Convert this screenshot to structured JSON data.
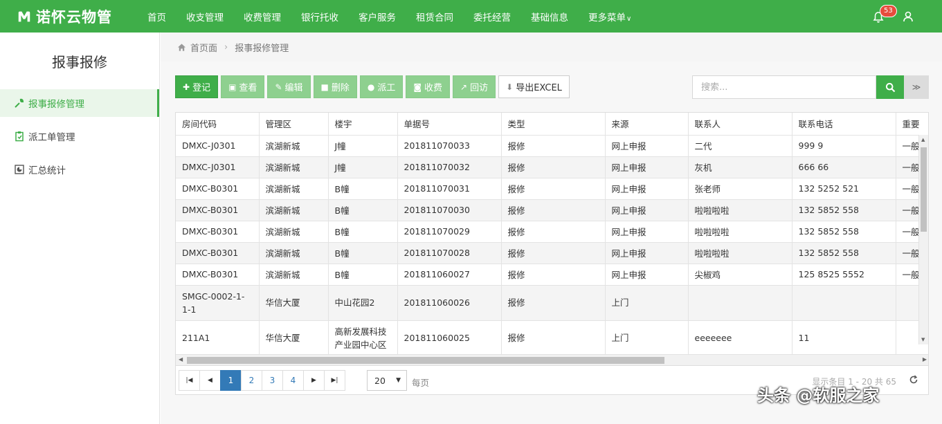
{
  "app": {
    "brand_name": "诺怀云物管",
    "logo_icon": "m-logo-icon",
    "accent_color": "#3fae49"
  },
  "nav": {
    "items": [
      "首页",
      "收支管理",
      "收费管理",
      "银行托收",
      "客户服务",
      "租赁合同",
      "委托经营",
      "基础信息"
    ],
    "more_label": "更多菜单",
    "notification_count": "53"
  },
  "sidebar": {
    "title": "报事报修",
    "items": [
      {
        "label": "报事报修管理",
        "icon": "wrench-icon",
        "active": true
      },
      {
        "label": "派工单管理",
        "icon": "clipboard-icon",
        "active": false
      },
      {
        "label": "汇总统计",
        "icon": "chart-icon",
        "active": false
      }
    ]
  },
  "breadcrumb": {
    "home": "首页面",
    "current": "报事报修管理"
  },
  "toolbar": {
    "register": "登记",
    "view": "查看",
    "edit": "编辑",
    "delete": "删除",
    "dispatch": "派工",
    "charge": "收费",
    "revisit": "回访",
    "export": "导出EXCEL"
  },
  "search": {
    "placeholder": "搜索..."
  },
  "table": {
    "columns": [
      "房间代码",
      "管理区",
      "楼宇",
      "单据号",
      "类型",
      "来源",
      "联系人",
      "联系电话",
      "重要"
    ],
    "rows": [
      [
        "DMXC-J0301",
        "滨湖新城",
        "J幢",
        "201811070033",
        "报修",
        "网上申报",
        "二代",
        "999 9",
        "一般"
      ],
      [
        "DMXC-J0301",
        "滨湖新城",
        "J幢",
        "201811070032",
        "报修",
        "网上申报",
        "灰机",
        "666 66",
        "一般"
      ],
      [
        "DMXC-B0301",
        "滨湖新城",
        "B幢",
        "201811070031",
        "报修",
        "网上申报",
        "张老师",
        "132 5252 521",
        "一般"
      ],
      [
        "DMXC-B0301",
        "滨湖新城",
        "B幢",
        "201811070030",
        "报修",
        "网上申报",
        "啦啦啦啦",
        "132 5852 558",
        "一般"
      ],
      [
        "DMXC-B0301",
        "滨湖新城",
        "B幢",
        "201811070029",
        "报修",
        "网上申报",
        "啦啦啦啦",
        "132 5852 558",
        "一般"
      ],
      [
        "DMXC-B0301",
        "滨湖新城",
        "B幢",
        "201811070028",
        "报修",
        "网上申报",
        "啦啦啦啦",
        "132 5852 558",
        "一般"
      ],
      [
        "DMXC-B0301",
        "滨湖新城",
        "B幢",
        "201811060027",
        "报修",
        "网上申报",
        "尖椒鸡",
        "125 8525 5552",
        "一般"
      ],
      [
        "SMGC-0002-1-1-1",
        "华信大厦",
        "中山花园2",
        "201811060026",
        "报修",
        "上门",
        "",
        "",
        ""
      ],
      [
        "211A1",
        "华信大厦",
        "高新发展科技产业园中心区",
        "201811060025",
        "报修",
        "上门",
        "eeeeeee",
        "11",
        ""
      ]
    ]
  },
  "pagination": {
    "pages": [
      "1",
      "2",
      "3",
      "4"
    ],
    "current": "1",
    "page_size": "20",
    "per_page_label": "每页",
    "info": "显示条目 1 - 20 共 65"
  },
  "watermark": {
    "text": "头条 @软服之家"
  }
}
